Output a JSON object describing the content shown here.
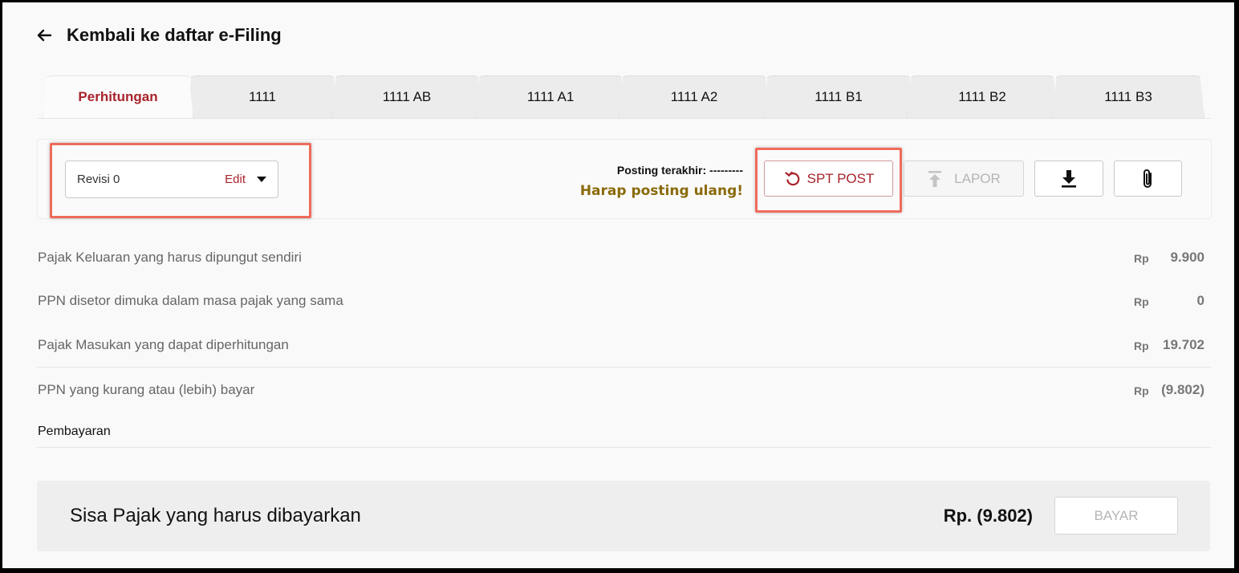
{
  "header": {
    "back_label": "Kembali ke daftar e-Filing"
  },
  "tabs": [
    {
      "label": "Perhitungan",
      "active": true
    },
    {
      "label": "1111"
    },
    {
      "label": "1111 AB"
    },
    {
      "label": "1111 A1"
    },
    {
      "label": "1111 A2"
    },
    {
      "label": "1111 B1"
    },
    {
      "label": "1111 B2"
    },
    {
      "label": "1111 B3"
    }
  ],
  "toolbar": {
    "revision": "Revisi 0",
    "edit_label": "Edit",
    "posting_last": "Posting terakhir: ---------",
    "posting_warning": "Harap posting ulang!",
    "spt_post_label": "SPT POST",
    "lapor_label": "LAPOR",
    "download_icon": "download-icon",
    "attach_icon": "paperclip-icon"
  },
  "rows": [
    {
      "label": "Pajak Keluaran yang harus dipungut sendiri",
      "currency": "Rp",
      "value": "9.900"
    },
    {
      "label": "PPN disetor dimuka dalam masa pajak yang sama",
      "currency": "Rp",
      "value": "0"
    },
    {
      "label": "Pajak Masukan yang dapat diperhitungan",
      "currency": "Rp",
      "value": "19.702"
    },
    {
      "label": "PPN yang kurang atau (lebih) bayar",
      "currency": "Rp",
      "value": "(9.802)"
    }
  ],
  "payment": {
    "label": "Pembayaran"
  },
  "summary": {
    "title": "Sisa Pajak yang harus dibayarkan",
    "amount": "Rp. (9.802)",
    "pay_label": "BAYAR"
  },
  "colors": {
    "accent": "#a8232b",
    "warning": "#8a6a0c",
    "highlight": "#ef6b5b"
  }
}
